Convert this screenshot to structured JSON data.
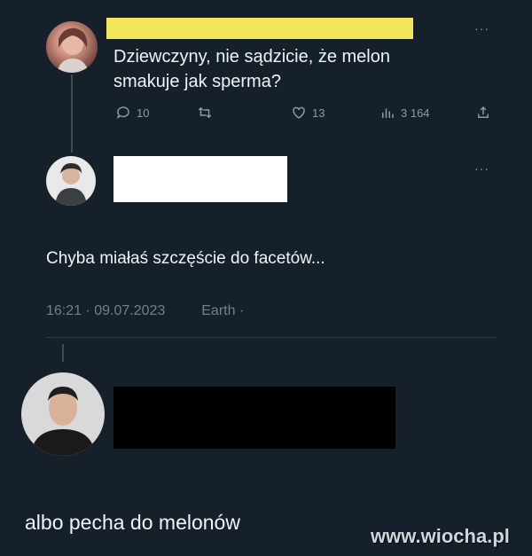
{
  "tweet1": {
    "text_line1": "Dziewczyny, nie sądzicie, że melon",
    "text_line2": "smakuje jak sperma?",
    "more": "···",
    "actions": {
      "reply_count": "10",
      "retweet_count": "",
      "like_count": "13",
      "views_count": "3 164"
    },
    "icons": [
      "reply-icon",
      "retweet-icon",
      "like-icon",
      "views-icon",
      "share-icon"
    ]
  },
  "tweet2": {
    "more": "···",
    "text": "Chyba miałaś szczęście do facetów...",
    "timestamp": "16:21 · 09.07.2023",
    "source": "Earth ·"
  },
  "reply": {
    "text": "albo pecha do melonów"
  },
  "watermark": "www.wiocha.pl",
  "colors": {
    "background": "#15202b",
    "yellow_redaction": "#f3e65a",
    "muted": "#8b98a5"
  }
}
